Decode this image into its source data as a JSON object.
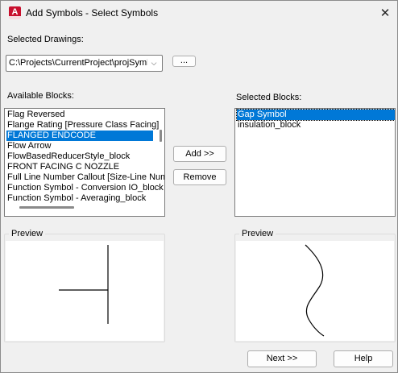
{
  "window": {
    "title": "Add Symbols - Select Symbols",
    "app_icon_letter": "A",
    "close_glyph": "✕"
  },
  "drawings": {
    "label": "Selected Drawings:",
    "combo_value": "C:\\Projects\\CurrentProject\\projSymb",
    "combo_arrow": "⌵",
    "browse_label": "..."
  },
  "available": {
    "label": "Available Blocks:",
    "items": [
      {
        "label": "Flag Reversed",
        "selected": false
      },
      {
        "label": "Flange Rating [Pressure Class Facing]",
        "selected": false
      },
      {
        "label": "FLANGED ENDCODE",
        "selected": true
      },
      {
        "label": "Flow Arrow",
        "selected": false
      },
      {
        "label": "FlowBasedReducerStyle_block",
        "selected": false
      },
      {
        "label": "FRONT FACING C NOZZLE",
        "selected": false
      },
      {
        "label": "Full Line Number Callout [Size-Line Num",
        "selected": false
      },
      {
        "label": "Function Symbol -  Conversion IO_block",
        "selected": false
      },
      {
        "label": "Function Symbol -  Averaging_block",
        "selected": false
      }
    ]
  },
  "actions": {
    "add_label": "Add >>",
    "remove_label": "Remove"
  },
  "selected_blocks": {
    "label": "Selected Blocks:",
    "items": [
      {
        "label": "Gap Symbol",
        "selected": true
      },
      {
        "label": "insulation_block",
        "selected": false
      }
    ]
  },
  "preview_left": {
    "label": "Preview"
  },
  "preview_right": {
    "label": "Preview"
  },
  "footer": {
    "next_label": "Next >>",
    "help_label": "Help"
  }
}
